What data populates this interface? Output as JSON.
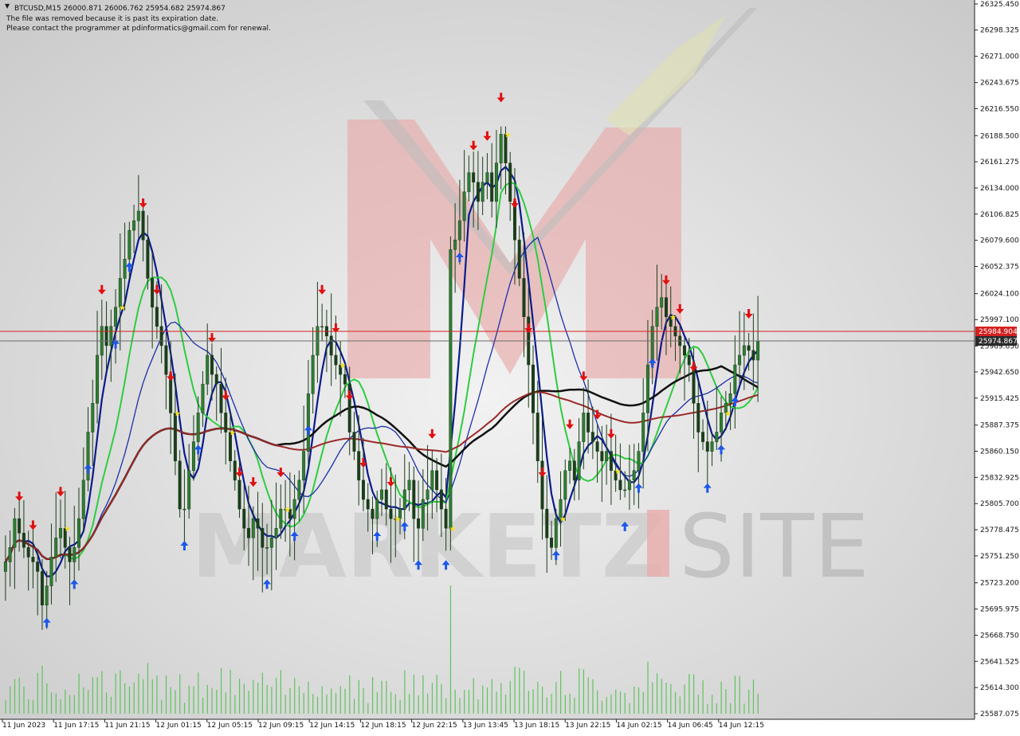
{
  "info": {
    "header": "BTCUSD,M15  26000.871 26006.762 25954.682 25974.867",
    "line1": "The file was removed because it is past its expiration date.",
    "line2": "Please contact the programmer at pdinformatics@gmail.com for renewal."
  },
  "watermark": {
    "text_left": "MARKETZ",
    "text_right": "SITE"
  },
  "colors": {
    "background": "#ffffff",
    "bull_candle": "#2e7d32",
    "bear_candle": "#1b3d1b",
    "volume": "#5ec45e",
    "ma_black": "#111111",
    "ma_darkred": "#9b2a2a",
    "ma_green": "#2ecc40",
    "ma_navy": "#0a1a8c",
    "ma_blue": "#1b2fa8",
    "arrow_up": "#1c57e8",
    "arrow_down": "#e01010",
    "star": "#f5e11a",
    "bid_line": "#d42020",
    "ask_line": "#6b6b6b",
    "bid_label_bg": "#d42020",
    "ask_label_bg": "#2b2b2b"
  },
  "chart_data": {
    "type": "candlestick",
    "symbol": "BTCUSD",
    "timeframe": "M15",
    "y_range": [
      25587.07,
      26325.45
    ],
    "y_ticks": [
      "26325.450",
      "26298.325",
      "26271.000",
      "26243.675",
      "26216.550",
      "26188.500",
      "26161.275",
      "26134.000",
      "26106.825",
      "26079.600",
      "26052.375",
      "26024.100",
      "25997.100",
      "25969.650",
      "25942.650",
      "25915.425",
      "25887.375",
      "25860.150",
      "25832.925",
      "25805.700",
      "25778.475",
      "25751.250",
      "25723.200",
      "25695.975",
      "25668.750",
      "25641.525",
      "25614.300",
      "25587.075"
    ],
    "x_ticks": [
      "11 Jun 2023",
      "11 Jun 17:15",
      "11 Jun 21:15",
      "12 Jun 01:15",
      "12 Jun 05:15",
      "12 Jun 09:15",
      "12 Jun 14:15",
      "12 Jun 18:15",
      "12 Jun 22:15",
      "13 Jun 13:45",
      "13 Jun 18:15",
      "13 Jun 22:15",
      "14 Jun 02:15",
      "14 Jun 06:45",
      "14 Jun 12:15"
    ],
    "bid_price": "25984.904",
    "ask_price": "25974.867",
    "candles_close": [
      25745,
      25760,
      25790,
      25775,
      25760,
      25750,
      25745,
      25735,
      25700,
      25720,
      25750,
      25770,
      25780,
      25760,
      25745,
      25760,
      25790,
      25830,
      25880,
      25910,
      25960,
      25990,
      25970,
      25990,
      26010,
      26040,
      26060,
      26090,
      26100,
      26110,
      26080,
      26040,
      26010,
      25990,
      25970,
      25940,
      25900,
      25850,
      25800,
      25800,
      25840,
      25870,
      25900,
      25930,
      25960,
      25940,
      25930,
      25900,
      25880,
      25850,
      25830,
      25800,
      25780,
      25770,
      25790,
      25780,
      25760,
      25760,
      25770,
      25780,
      25800,
      25800,
      25790,
      25810,
      25830,
      25860,
      25920,
      25960,
      25990,
      25990,
      25980,
      25960,
      25950,
      25940,
      25930,
      25880,
      25860,
      25830,
      25810,
      25800,
      25790,
      25810,
      25820,
      25800,
      25790,
      25790,
      25800,
      25820,
      25830,
      25790,
      25780,
      25810,
      25820,
      25840,
      25820,
      25800,
      25780,
      26070,
      26080,
      26100,
      26130,
      26150,
      26140,
      26120,
      26140,
      26150,
      26120,
      26160,
      26190,
      26160,
      26120,
      26080,
      26040,
      26000,
      25950,
      25900,
      25850,
      25800,
      25770,
      25760,
      25790,
      25810,
      25840,
      25850,
      25830,
      25870,
      25900,
      25880,
      25870,
      25860,
      25850,
      25860,
      25840,
      25830,
      25820,
      25820,
      25830,
      25840,
      25860,
      25900,
      25950,
      25990,
      26010,
      26020,
      26000,
      25990,
      25980,
      25970,
      25960,
      25950,
      25910,
      25880,
      25870,
      25860,
      25870,
      25880,
      25900,
      25910,
      25920,
      25950,
      25960,
      25970,
      25965,
      25955,
      25975
    ]
  }
}
